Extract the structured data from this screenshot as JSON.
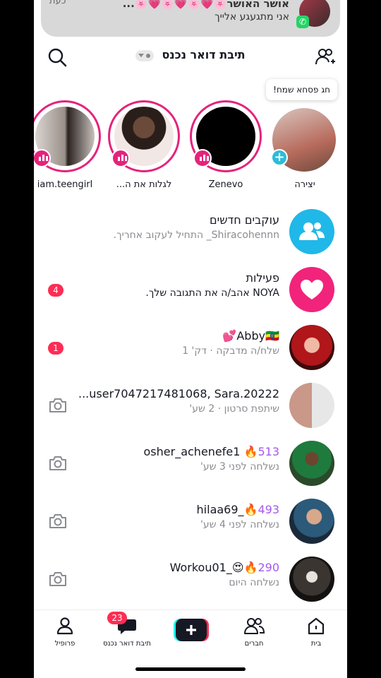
{
  "notification": {
    "title": "אושר האושר🌸💗🌸💗🌸💗🌸...",
    "body": "אני מתגעגע אלייך",
    "time": "כעת"
  },
  "header": {
    "title": "תיבת דואר נכנס",
    "search_icon": "search-icon",
    "add_friends_icon": "add-friends-icon"
  },
  "tooltip": "חג פסחא שמח!",
  "stories": [
    {
      "name": "יצירה"
    },
    {
      "name": "Zenevo"
    },
    {
      "name": "לגלות את ה..."
    },
    {
      "name": "iam.teengirl"
    }
  ],
  "rows": [
    {
      "line1": "עוקבים חדשים",
      "line2": "Shiracohennn_ התחיל לעקוב אחריך."
    },
    {
      "line1": "פעילות",
      "line2": "NOYA אהב/ה את התגובה שלך.",
      "count": "4"
    },
    {
      "line1": "Abby🇪🇹💕",
      "line2": "שלח/ה מדבקה · דק' 1",
      "count": "1"
    },
    {
      "line1": "user7047217481068, Sara.20222...",
      "line2": "שיתפת סרטון · 2 שע'"
    },
    {
      "line1_name": "osher_achenefe1",
      "streak": "513",
      "line2": "נשלחה לפני 3 שע'"
    },
    {
      "line1_name": "_hilaa69",
      "streak": "493",
      "line2": "נשלחה לפני 4 שע'"
    },
    {
      "line1_name": "😍_Workou01",
      "streak": "290",
      "line2": "נשלחה היום"
    }
  ],
  "nav": {
    "home": "בית",
    "friends": "חברים",
    "inbox": "תיבת דואר נכנס",
    "inbox_badge": "23",
    "profile": "פרופיל"
  },
  "colors": {
    "accent": "#fe2c55",
    "story_ring": "#e4237b",
    "streak": "#a758ef",
    "followers_icon_bg": "#1fb8e8",
    "activity_icon_bg": "#f2237b"
  }
}
